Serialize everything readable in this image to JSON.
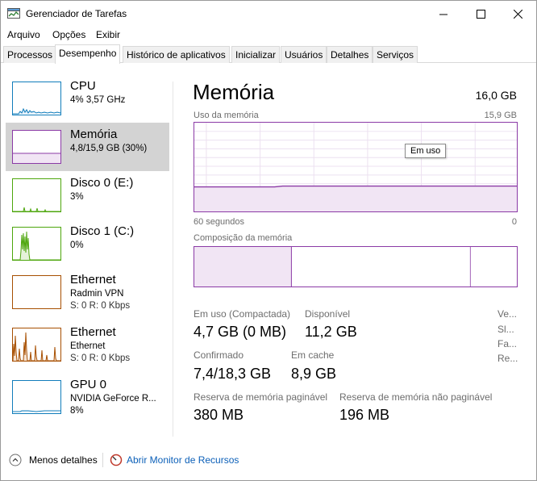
{
  "window": {
    "title": "Gerenciador de Tarefas"
  },
  "menu": [
    "Arquivo",
    "Opções",
    "Exibir"
  ],
  "tabs": [
    "Processos",
    "Desempenho",
    "Histórico de aplicativos",
    "Inicializar",
    "Usuários",
    "Detalhes",
    "Serviços"
  ],
  "active_tab": "Desempenho",
  "resources": [
    {
      "title": "CPU",
      "sub": "4%  3,57 GHz",
      "sub2": ""
    },
    {
      "title": "Memória",
      "sub": "4,8/15,9 GB (30%)",
      "sub2": ""
    },
    {
      "title": "Disco 0 (E:)",
      "sub": "3%",
      "sub2": ""
    },
    {
      "title": "Disco 1 (C:)",
      "sub": "0%",
      "sub2": ""
    },
    {
      "title": "Ethernet",
      "sub": "Radmin VPN",
      "sub2": "S: 0  R: 0 Kbps"
    },
    {
      "title": "Ethernet",
      "sub": "Ethernet",
      "sub2": "S: 0  R: 0 Kbps"
    },
    {
      "title": "GPU 0",
      "sub": "NVIDIA GeForce R...",
      "sub2": "8%"
    }
  ],
  "colors": {
    "cpu": "#117dbb",
    "memory": "#8b3aa6",
    "disk": "#4da60c",
    "ethernet": "#a74f01",
    "gpu": "#117dbb"
  },
  "memory": {
    "title": "Memória",
    "total": "16,0 GB",
    "usage_label": "Uso da memória",
    "usage_max": "15,9 GB",
    "tooltip": "Em uso",
    "axis_left": "60 segundos",
    "axis_right": "0",
    "composition_label": "Composição da memória",
    "in_use_fraction": 0.3,
    "stats": {
      "in_use_label": "Em uso (Compactada)",
      "in_use_value": "4,7 GB (0 MB)",
      "available_label": "Disponível",
      "available_value": "11,2 GB",
      "committed_label": "Confirmado",
      "committed_value": "7,4/18,3 GB",
      "cached_label": "Em cache",
      "cached_value": "8,9 GB",
      "paged_label": "Reserva de memória paginável",
      "paged_value": "380 MB",
      "nonpaged_label": "Reserva de memória não paginável",
      "nonpaged_value": "196 MB"
    },
    "side_labels": [
      "Ve...",
      "Sl...",
      "Fa...",
      "Re..."
    ]
  },
  "footer": {
    "less_details": "Menos detalhes",
    "open_monitor": "Abrir Monitor de Recursos"
  }
}
